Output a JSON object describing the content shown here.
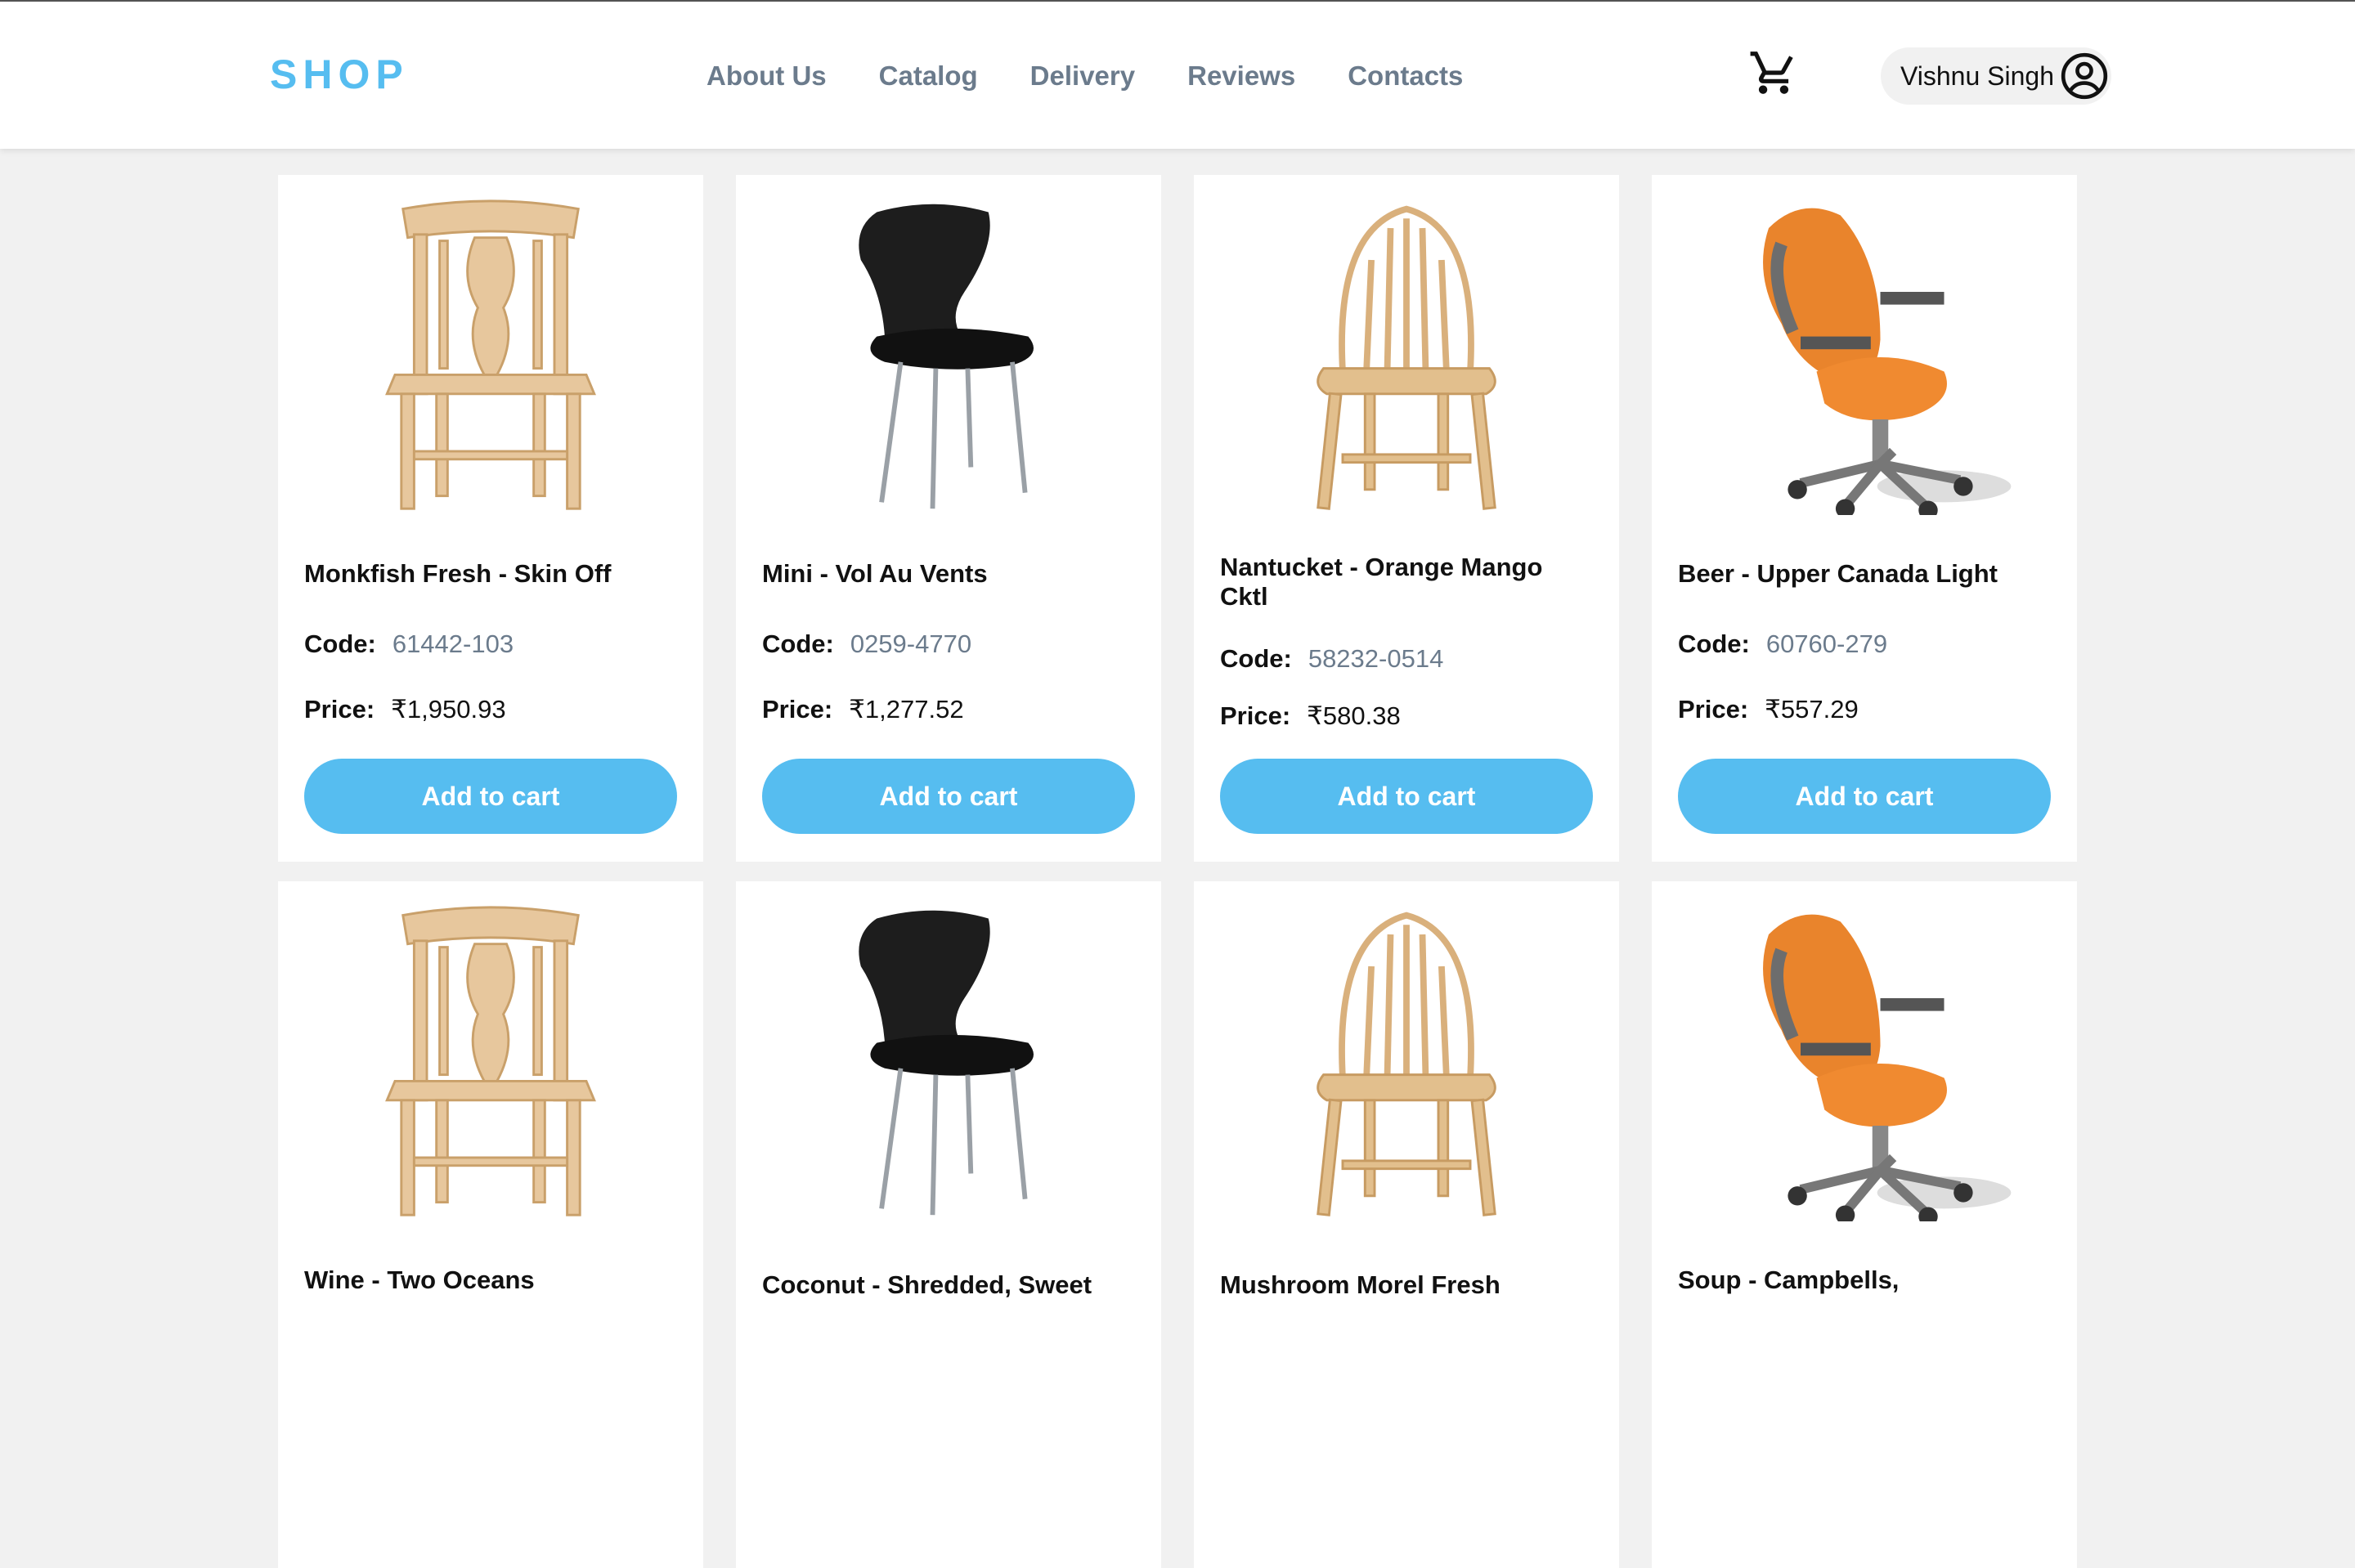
{
  "header": {
    "logo": "SHOP",
    "nav": [
      "About Us",
      "Catalog",
      "Delivery",
      "Reviews",
      "Contacts"
    ],
    "cart_icon": "cart-icon",
    "user_name": "Vishnu Singh",
    "user_icon": "account-circle-icon"
  },
  "labels": {
    "code": "Code:",
    "price": "Price:",
    "add_to_cart": "Add to cart"
  },
  "products": [
    {
      "name": "Monkfish Fresh - Skin Off",
      "code": "61442-103",
      "price": "₹1,950.93",
      "image": "wooden-fiddleback-chair"
    },
    {
      "name": "Mini - Vol Au Vents",
      "code": "0259-4770",
      "price": "₹1,277.52",
      "image": "black-modern-chair"
    },
    {
      "name": "Nantucket - Orange Mango Cktl",
      "code": "58232-0514",
      "price": "₹580.38",
      "image": "windsor-chair"
    },
    {
      "name": "Beer - Upper Canada Light",
      "code": "60760-279",
      "price": "₹557.29",
      "image": "orange-office-chair"
    },
    {
      "name": "Wine - Two Oceans",
      "image": "wooden-fiddleback-chair"
    },
    {
      "name": "Coconut - Shredded, Sweet",
      "image": "black-modern-chair"
    },
    {
      "name": "Mushroom Morel Fresh",
      "image": "windsor-chair"
    },
    {
      "name": "Soup - Campbells,",
      "image": "orange-office-chair"
    }
  ]
}
